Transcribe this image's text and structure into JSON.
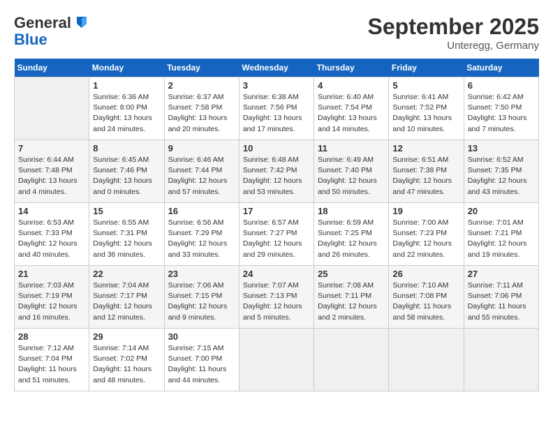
{
  "header": {
    "logo_line1": "General",
    "logo_line2": "Blue",
    "month": "September 2025",
    "location": "Unteregg, Germany"
  },
  "weekdays": [
    "Sunday",
    "Monday",
    "Tuesday",
    "Wednesday",
    "Thursday",
    "Friday",
    "Saturday"
  ],
  "weeks": [
    [
      {
        "day": null
      },
      {
        "day": "1",
        "sunrise": "6:36 AM",
        "sunset": "8:00 PM",
        "daylight": "13 hours and 24 minutes."
      },
      {
        "day": "2",
        "sunrise": "6:37 AM",
        "sunset": "7:58 PM",
        "daylight": "13 hours and 20 minutes."
      },
      {
        "day": "3",
        "sunrise": "6:38 AM",
        "sunset": "7:56 PM",
        "daylight": "13 hours and 17 minutes."
      },
      {
        "day": "4",
        "sunrise": "6:40 AM",
        "sunset": "7:54 PM",
        "daylight": "13 hours and 14 minutes."
      },
      {
        "day": "5",
        "sunrise": "6:41 AM",
        "sunset": "7:52 PM",
        "daylight": "13 hours and 10 minutes."
      },
      {
        "day": "6",
        "sunrise": "6:42 AM",
        "sunset": "7:50 PM",
        "daylight": "13 hours and 7 minutes."
      }
    ],
    [
      {
        "day": "7",
        "sunrise": "6:44 AM",
        "sunset": "7:48 PM",
        "daylight": "13 hours and 4 minutes."
      },
      {
        "day": "8",
        "sunrise": "6:45 AM",
        "sunset": "7:46 PM",
        "daylight": "13 hours and 0 minutes."
      },
      {
        "day": "9",
        "sunrise": "6:46 AM",
        "sunset": "7:44 PM",
        "daylight": "12 hours and 57 minutes."
      },
      {
        "day": "10",
        "sunrise": "6:48 AM",
        "sunset": "7:42 PM",
        "daylight": "12 hours and 53 minutes."
      },
      {
        "day": "11",
        "sunrise": "6:49 AM",
        "sunset": "7:40 PM",
        "daylight": "12 hours and 50 minutes."
      },
      {
        "day": "12",
        "sunrise": "6:51 AM",
        "sunset": "7:38 PM",
        "daylight": "12 hours and 47 minutes."
      },
      {
        "day": "13",
        "sunrise": "6:52 AM",
        "sunset": "7:35 PM",
        "daylight": "12 hours and 43 minutes."
      }
    ],
    [
      {
        "day": "14",
        "sunrise": "6:53 AM",
        "sunset": "7:33 PM",
        "daylight": "12 hours and 40 minutes."
      },
      {
        "day": "15",
        "sunrise": "6:55 AM",
        "sunset": "7:31 PM",
        "daylight": "12 hours and 36 minutes."
      },
      {
        "day": "16",
        "sunrise": "6:56 AM",
        "sunset": "7:29 PM",
        "daylight": "12 hours and 33 minutes."
      },
      {
        "day": "17",
        "sunrise": "6:57 AM",
        "sunset": "7:27 PM",
        "daylight": "12 hours and 29 minutes."
      },
      {
        "day": "18",
        "sunrise": "6:59 AM",
        "sunset": "7:25 PM",
        "daylight": "12 hours and 26 minutes."
      },
      {
        "day": "19",
        "sunrise": "7:00 AM",
        "sunset": "7:23 PM",
        "daylight": "12 hours and 22 minutes."
      },
      {
        "day": "20",
        "sunrise": "7:01 AM",
        "sunset": "7:21 PM",
        "daylight": "12 hours and 19 minutes."
      }
    ],
    [
      {
        "day": "21",
        "sunrise": "7:03 AM",
        "sunset": "7:19 PM",
        "daylight": "12 hours and 16 minutes."
      },
      {
        "day": "22",
        "sunrise": "7:04 AM",
        "sunset": "7:17 PM",
        "daylight": "12 hours and 12 minutes."
      },
      {
        "day": "23",
        "sunrise": "7:06 AM",
        "sunset": "7:15 PM",
        "daylight": "12 hours and 9 minutes."
      },
      {
        "day": "24",
        "sunrise": "7:07 AM",
        "sunset": "7:13 PM",
        "daylight": "12 hours and 5 minutes."
      },
      {
        "day": "25",
        "sunrise": "7:08 AM",
        "sunset": "7:11 PM",
        "daylight": "12 hours and 2 minutes."
      },
      {
        "day": "26",
        "sunrise": "7:10 AM",
        "sunset": "7:08 PM",
        "daylight": "11 hours and 58 minutes."
      },
      {
        "day": "27",
        "sunrise": "7:11 AM",
        "sunset": "7:06 PM",
        "daylight": "11 hours and 55 minutes."
      }
    ],
    [
      {
        "day": "28",
        "sunrise": "7:12 AM",
        "sunset": "7:04 PM",
        "daylight": "11 hours and 51 minutes."
      },
      {
        "day": "29",
        "sunrise": "7:14 AM",
        "sunset": "7:02 PM",
        "daylight": "11 hours and 48 minutes."
      },
      {
        "day": "30",
        "sunrise": "7:15 AM",
        "sunset": "7:00 PM",
        "daylight": "11 hours and 44 minutes."
      },
      {
        "day": null
      },
      {
        "day": null
      },
      {
        "day": null
      },
      {
        "day": null
      }
    ]
  ]
}
